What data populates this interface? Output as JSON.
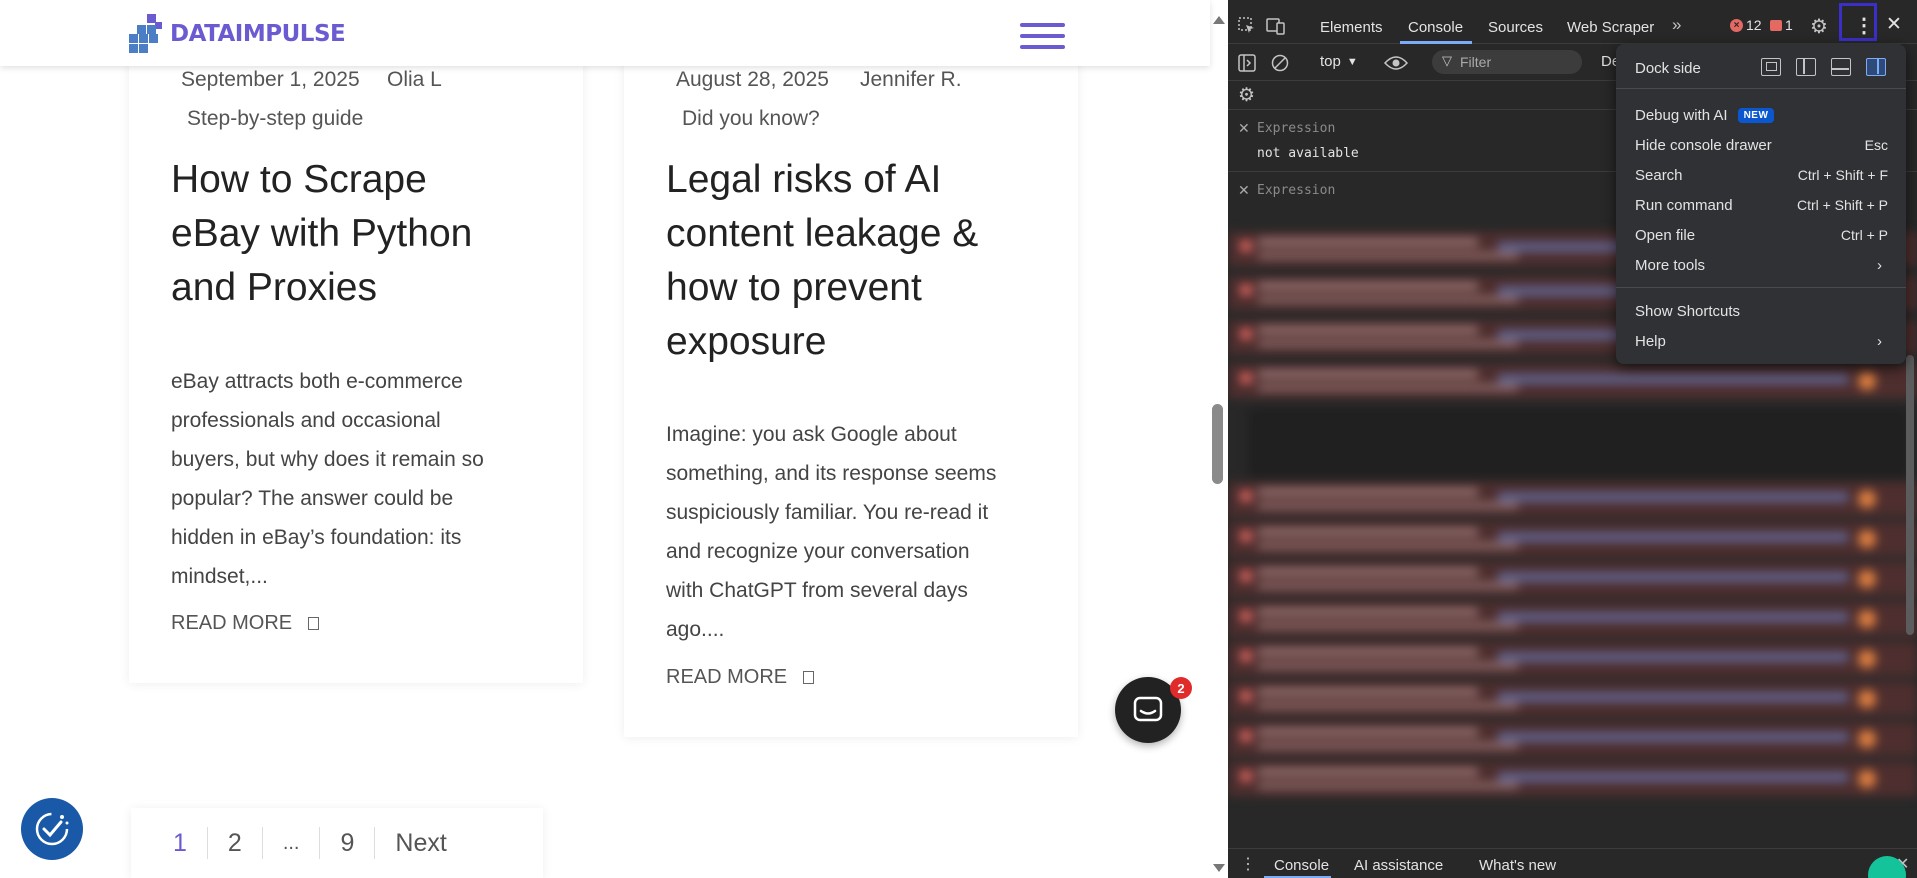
{
  "site": {
    "logo_text": "DATAIMPULSE",
    "brand_color": "#6a5bd1"
  },
  "cards": [
    {
      "date": "September 1, 2025",
      "author": "Olia L",
      "category": "Step-by-step guide",
      "title_lines": [
        "How to Scrape",
        "eBay with Python",
        "and Proxies"
      ],
      "excerpt_lines": [
        "eBay attracts both e-commerce",
        "professionals and occasional",
        "buyers, but why does it remain so",
        "popular? The answer could be",
        "hidden in eBay’s foundation: its",
        "mindset,..."
      ],
      "read_more": "READ MORE"
    },
    {
      "date": "August 28, 2025",
      "author": "Jennifer R.",
      "category": "Did you know?",
      "title_lines": [
        "Legal risks of AI",
        "content leakage &",
        "how to prevent",
        "exposure"
      ],
      "excerpt_lines": [
        "Imagine: you ask Google about",
        "something, and its response seems",
        "suspiciously familiar. You re-read it",
        "and recognize your conversation",
        "with ChatGPT from several days",
        "ago...."
      ],
      "read_more": "READ MORE"
    }
  ],
  "pagination": {
    "pages": [
      "1",
      "2",
      "...",
      "9"
    ],
    "next": "Next",
    "active": "1"
  },
  "chat": {
    "badge_count": "2"
  },
  "devtools": {
    "tabs": {
      "elements": "Elements",
      "console": "Console",
      "sources": "Sources",
      "web_scraper": "Web Scraper"
    },
    "errors": "12",
    "warnings": "1",
    "context": "top",
    "filter_placeholder": "Filter",
    "default_levels": "De",
    "expressions": [
      {
        "label": "Expression",
        "value": "not available"
      },
      {
        "label": "Expression",
        "value": ""
      }
    ],
    "drawer_tabs": {
      "console": "Console",
      "ai_assistance": "AI assistance",
      "whats_new": "What's new"
    }
  },
  "menu": {
    "dock_side": "Dock side",
    "debug_ai": "Debug with AI",
    "new_badge": "NEW",
    "hide_drawer": "Hide console drawer",
    "hide_drawer_sc": "Esc",
    "search": "Search",
    "search_sc": "Ctrl + Shift + F",
    "run_command": "Run command",
    "run_command_sc": "Ctrl + Shift + P",
    "open_file": "Open file",
    "open_file_sc": "Ctrl + P",
    "more_tools": "More tools",
    "show_shortcuts": "Show Shortcuts",
    "help": "Help"
  },
  "icons": {
    "menu": "hamburger-icon",
    "cookie": "cookie-check-icon",
    "chat": "chat-icon",
    "kebab": "kebab-icon",
    "gear": "gear-icon",
    "close": "close-icon"
  }
}
